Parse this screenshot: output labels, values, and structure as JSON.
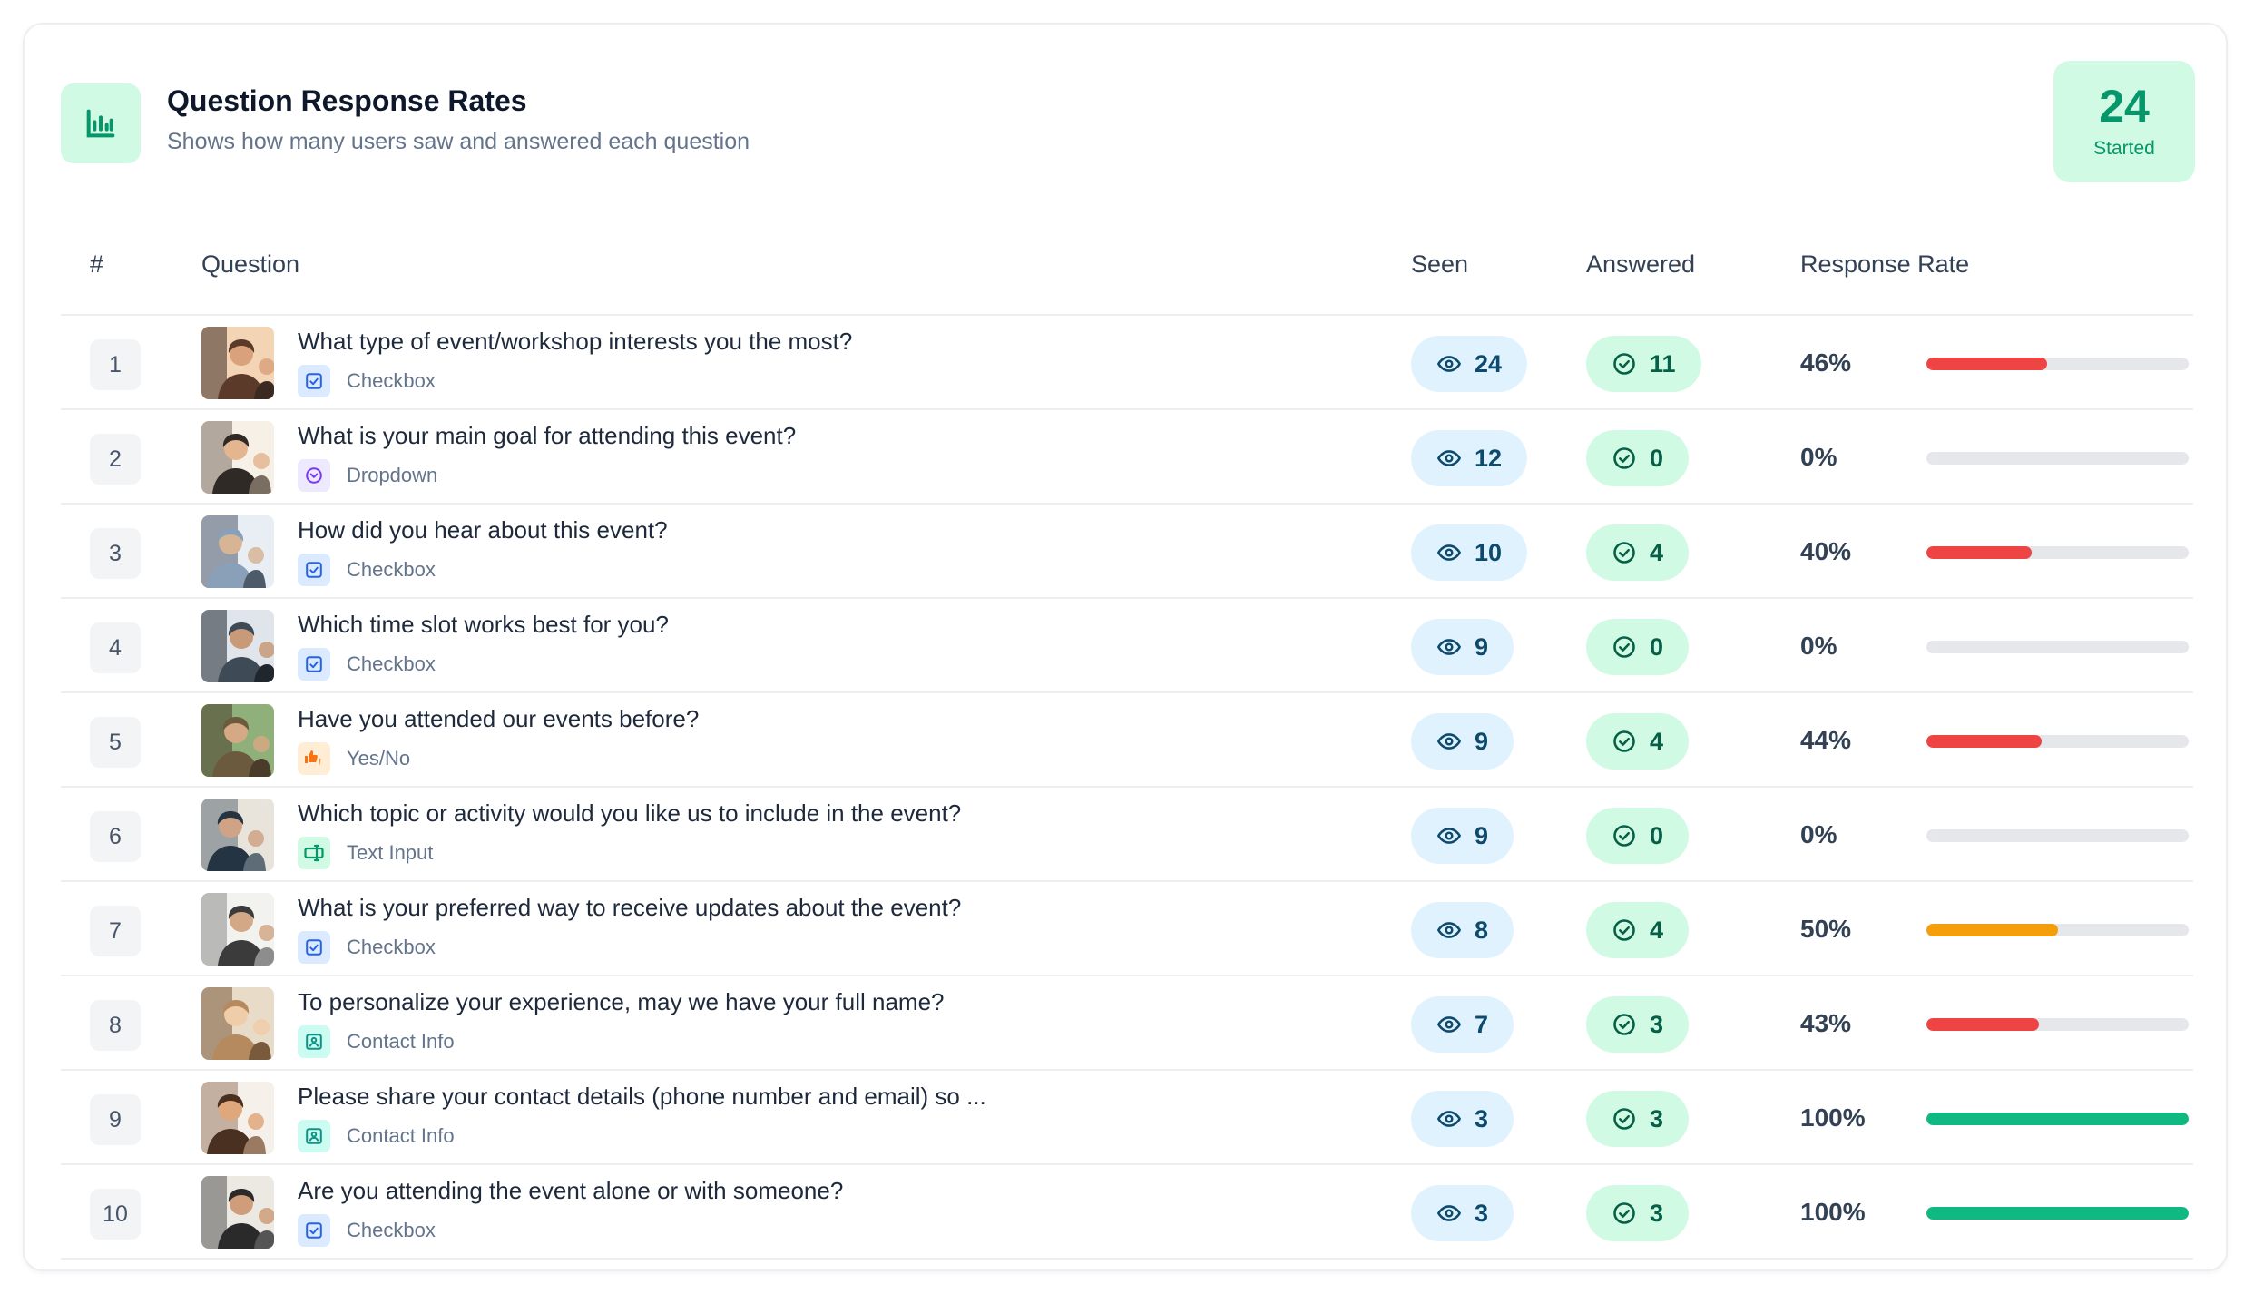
{
  "header": {
    "title": "Question Response Rates",
    "subtitle": "Shows how many users saw and answered each question",
    "started_count": "24",
    "started_label": "Started"
  },
  "columns": {
    "num": "#",
    "question": "Question",
    "seen": "Seen",
    "answered": "Answered",
    "rate": "Response Rate"
  },
  "colors": {
    "low": "#ef4444",
    "mid": "#f59e0b",
    "high": "#10b981",
    "track": "#e5e7eb"
  },
  "rows": [
    {
      "num": "1",
      "question": "What type of event/workshop interests you the most?",
      "type": "Checkbox",
      "type_icon": "checkbox-icon",
      "seen": "24",
      "answered": "11",
      "rate": "46%",
      "rate_value": 46,
      "level": "low"
    },
    {
      "num": "2",
      "question": "What is your main goal for attending this event?",
      "type": "Dropdown",
      "type_icon": "dropdown-icon",
      "seen": "12",
      "answered": "0",
      "rate": "0%",
      "rate_value": 0,
      "level": "low"
    },
    {
      "num": "3",
      "question": "How did you hear about this event?",
      "type": "Checkbox",
      "type_icon": "checkbox-icon",
      "seen": "10",
      "answered": "4",
      "rate": "40%",
      "rate_value": 40,
      "level": "low"
    },
    {
      "num": "4",
      "question": "Which time slot works best for you?",
      "type": "Checkbox",
      "type_icon": "checkbox-icon",
      "seen": "9",
      "answered": "0",
      "rate": "0%",
      "rate_value": 0,
      "level": "low"
    },
    {
      "num": "5",
      "question": "Have you attended our events before?",
      "type": "Yes/No",
      "type_icon": "thumbs-icon",
      "seen": "9",
      "answered": "4",
      "rate": "44%",
      "rate_value": 44,
      "level": "low"
    },
    {
      "num": "6",
      "question": "Which topic or activity would you like us to include in the event?",
      "type": "Text Input",
      "type_icon": "text-input-icon",
      "seen": "9",
      "answered": "0",
      "rate": "0%",
      "rate_value": 0,
      "level": "low"
    },
    {
      "num": "7",
      "question": "What is your preferred way to receive updates about the event?",
      "type": "Checkbox",
      "type_icon": "checkbox-icon",
      "seen": "8",
      "answered": "4",
      "rate": "50%",
      "rate_value": 50,
      "level": "mid"
    },
    {
      "num": "8",
      "question": "To personalize your experience, may we have your full name?",
      "type": "Contact Info",
      "type_icon": "contact-card-icon",
      "seen": "7",
      "answered": "3",
      "rate": "43%",
      "rate_value": 43,
      "level": "low"
    },
    {
      "num": "9",
      "question": "Please share your contact details (phone number and email) so ...",
      "type": "Contact Info",
      "type_icon": "contact-card-icon",
      "seen": "3",
      "answered": "3",
      "rate": "100%",
      "rate_value": 100,
      "level": "high"
    },
    {
      "num": "10",
      "question": "Are you attending the event alone or with someone?",
      "type": "Checkbox",
      "type_icon": "checkbox-icon",
      "seen": "3",
      "answered": "3",
      "rate": "100%",
      "rate_value": 100,
      "level": "high"
    }
  ]
}
